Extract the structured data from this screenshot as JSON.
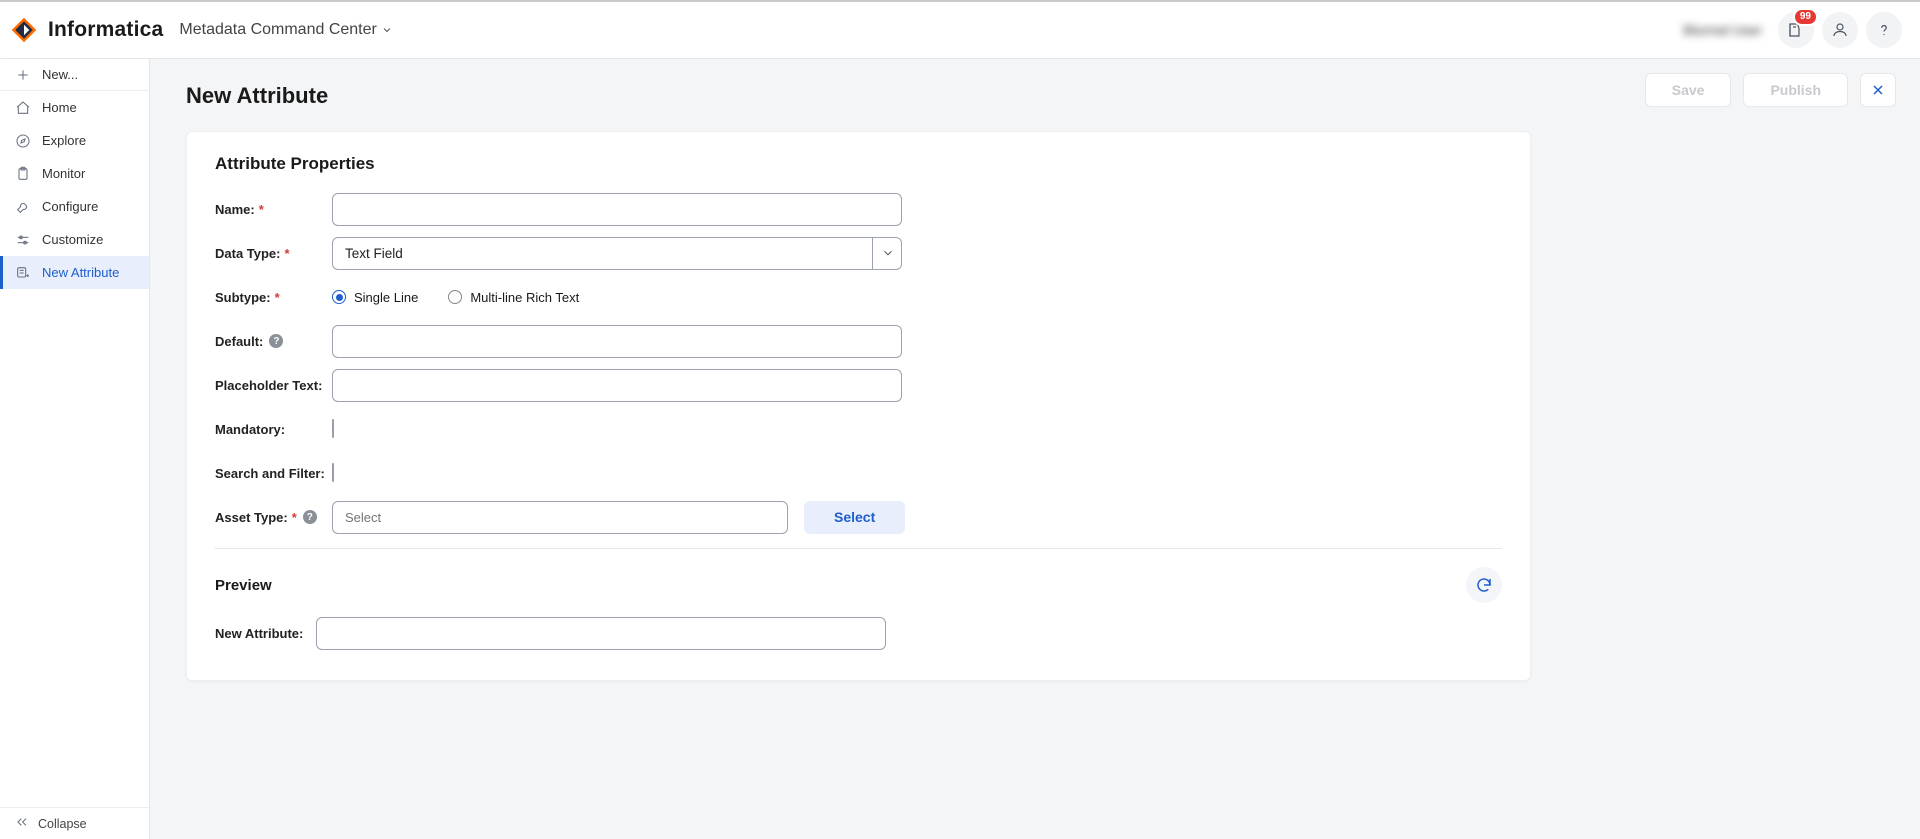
{
  "header": {
    "brand": "Informatica",
    "app_name": "Metadata Command Center",
    "user_display": "Blurred User",
    "notification_count": "99"
  },
  "sidebar": {
    "items": [
      {
        "id": "new",
        "label": "New...",
        "icon": "plus"
      },
      {
        "id": "home",
        "label": "Home",
        "icon": "home"
      },
      {
        "id": "explore",
        "label": "Explore",
        "icon": "compass"
      },
      {
        "id": "monitor",
        "label": "Monitor",
        "icon": "clipboard"
      },
      {
        "id": "configure",
        "label": "Configure",
        "icon": "wrench"
      },
      {
        "id": "customize",
        "label": "Customize",
        "icon": "sliders"
      },
      {
        "id": "newattr",
        "label": "New Attribute",
        "icon": "form-plus",
        "active": true
      }
    ],
    "collapse_label": "Collapse"
  },
  "actions": {
    "save": "Save",
    "publish": "Publish"
  },
  "page": {
    "title": "New Attribute",
    "section_title": "Attribute Properties",
    "preview_title": "Preview",
    "preview_field_label": "New Attribute:"
  },
  "form": {
    "name_label": "Name:",
    "name_value": "",
    "data_type_label": "Data Type:",
    "data_type_value": "Text Field",
    "subtype_label": "Subtype:",
    "subtype_options": {
      "single": "Single Line",
      "multi": "Multi-line Rich Text"
    },
    "subtype_selected": "single",
    "default_label": "Default:",
    "default_value": "",
    "placeholder_label": "Placeholder Text:",
    "placeholder_value": "",
    "mandatory_label": "Mandatory:",
    "mandatory_checked": false,
    "search_filter_label": "Search and Filter:",
    "search_filter_checked": false,
    "asset_type_label": "Asset Type:",
    "asset_type_placeholder": "Select",
    "asset_type_button": "Select"
  }
}
